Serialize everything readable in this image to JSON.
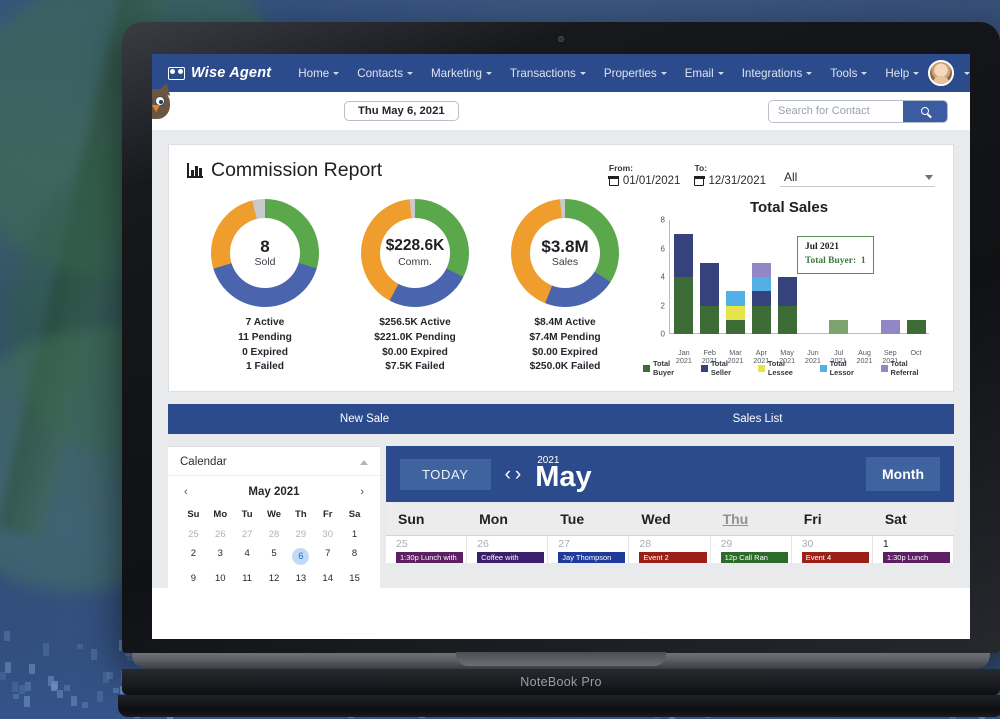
{
  "navbar": {
    "brand": "Wise Agent",
    "brand_icon": "wise-agent-logo-icon",
    "items": [
      {
        "label": "Home",
        "caret": true
      },
      {
        "label": "Contacts",
        "caret": true
      },
      {
        "label": "Marketing",
        "caret": true
      },
      {
        "label": "Transactions",
        "caret": true
      },
      {
        "label": "Properties",
        "caret": true
      },
      {
        "label": "Email",
        "caret": true
      },
      {
        "label": "Integrations",
        "caret": true
      },
      {
        "label": "Tools",
        "caret": true
      },
      {
        "label": "Help",
        "caret": true
      }
    ],
    "avatar_icon": "user-avatar",
    "avatar_caret_icon": "chevron-down-icon",
    "settings_icon": "gear-icon",
    "notifications_icon": "bell-icon"
  },
  "subbar": {
    "date_pill": "Thu May 6, 2021",
    "search_placeholder": "Search for Contact",
    "search_value": "",
    "search_icon": "search-icon",
    "mascot_icon": "owl-mascot-icon"
  },
  "report": {
    "title": "Commission Report",
    "title_icon": "bar-chart-icon",
    "filters": {
      "from_label": "From:",
      "from_value": "01/01/2021",
      "to_label": "To:",
      "to_value": "12/31/2021",
      "calendar_icon": "calendar-icon",
      "select_value": "All",
      "select_caret_icon": "chevron-down-icon"
    },
    "donuts": [
      {
        "value": "8",
        "label": "Sold",
        "stats": [
          "7 Active",
          "11 Pending",
          "0 Expired",
          "1 Failed"
        ],
        "segments": [
          {
            "name": "sold",
            "color": "#5aa84b",
            "pct": 29.6
          },
          {
            "name": "pending",
            "color": "#4a64ae",
            "pct": 40.7
          },
          {
            "name": "active",
            "color": "#ef9d2c",
            "pct": 25.9
          },
          {
            "name": "failed",
            "color": "#c8c9cb",
            "pct": 3.8
          }
        ]
      },
      {
        "value": "$228.6K",
        "label": "Comm.",
        "stats": [
          "$256.5K Active",
          "$221.0K Pending",
          "$0.00 Expired",
          "$7.5K Failed"
        ],
        "segments": [
          {
            "name": "comm",
            "color": "#5aa84b",
            "pct": 32.3
          },
          {
            "name": "pending",
            "color": "#4a64ae",
            "pct": 25.5
          },
          {
            "name": "active",
            "color": "#ef9d2c",
            "pct": 40.6
          },
          {
            "name": "failed",
            "color": "#c8c9cb",
            "pct": 1.6
          }
        ]
      },
      {
        "value": "$3.8M",
        "label": "Sales",
        "stats": [
          "$8.4M Active",
          "$7.4M Pending",
          "$0.00 Expired",
          "$250.0K Failed"
        ],
        "segments": [
          {
            "name": "sales",
            "color": "#5aa84b",
            "pct": 34.0
          },
          {
            "name": "pending",
            "color": "#4a64ae",
            "pct": 22.0
          },
          {
            "name": "active",
            "color": "#ef9d2c",
            "pct": 42.5
          },
          {
            "name": "failed",
            "color": "#c8c9cb",
            "pct": 1.5
          }
        ]
      }
    ],
    "tooltip": {
      "title": "Jul 2021",
      "row_label": "Total Buyer:",
      "row_value": "1"
    },
    "actions": [
      {
        "label": "New Sale"
      },
      {
        "label": "Sales List"
      }
    ]
  },
  "chart_data": {
    "type": "bar",
    "title": "Total Sales",
    "xlabel": "",
    "ylabel": "",
    "ylim": [
      0,
      8
    ],
    "yticks": [
      0,
      2,
      4,
      6,
      8
    ],
    "grid": false,
    "stacked": true,
    "legend_position": "bottom",
    "categories": [
      "Jan 2021",
      "Feb 2021",
      "Mar 2021",
      "Apr 2021",
      "May 2021",
      "Jun 2021",
      "Jul 2021",
      "Aug 2021",
      "Sep 2021",
      "Oct"
    ],
    "series": [
      {
        "name": "Total Buyer",
        "color": "#3d6b35",
        "values": [
          4,
          2,
          1,
          2,
          2,
          0,
          1,
          0,
          0,
          1
        ]
      },
      {
        "name": "Total Seller",
        "color": "#36427c",
        "values": [
          3,
          3,
          0,
          1,
          2,
          0,
          0,
          0,
          0,
          0
        ]
      },
      {
        "name": "Total Lessee",
        "color": "#e5e54a",
        "values": [
          0,
          0,
          1,
          0,
          0,
          0,
          0,
          0,
          0,
          0
        ]
      },
      {
        "name": "Total Lessor",
        "color": "#53b0e5",
        "values": [
          0,
          0,
          1,
          1,
          0,
          0,
          0,
          0,
          0,
          0
        ]
      },
      {
        "name": "Total Referral",
        "color": "#9287c4",
        "values": [
          0,
          0,
          0,
          1,
          0,
          0,
          0,
          0,
          1,
          0
        ]
      }
    ],
    "highlight": {
      "category": "Jul 2021",
      "series": "Total Buyer",
      "value": 1,
      "color": "#7fa36f"
    }
  },
  "calendar_sidebar": {
    "title": "Calendar",
    "collapse_icon": "chevron-up-icon",
    "month_title": "May 2021",
    "prev_icon": "chevron-left-icon",
    "next_icon": "chevron-right-icon",
    "dow": [
      "Su",
      "Mo",
      "Tu",
      "We",
      "Th",
      "Fr",
      "Sa"
    ],
    "weeks": [
      [
        {
          "d": "25",
          "mute": true
        },
        {
          "d": "26",
          "mute": true
        },
        {
          "d": "27",
          "mute": true
        },
        {
          "d": "28",
          "mute": true
        },
        {
          "d": "29",
          "mute": true
        },
        {
          "d": "30",
          "mute": true
        },
        {
          "d": "1"
        }
      ],
      [
        {
          "d": "2"
        },
        {
          "d": "3"
        },
        {
          "d": "4"
        },
        {
          "d": "5"
        },
        {
          "d": "6",
          "sel": true
        },
        {
          "d": "7"
        },
        {
          "d": "8"
        }
      ],
      [
        {
          "d": "9"
        },
        {
          "d": "10"
        },
        {
          "d": "11"
        },
        {
          "d": "12"
        },
        {
          "d": "13"
        },
        {
          "d": "14"
        },
        {
          "d": "15"
        }
      ]
    ]
  },
  "calendar_main": {
    "today_label": "TODAY",
    "prev_icon": "chevron-left-icon",
    "next_icon": "chevron-right-icon",
    "year": "2021",
    "month": "May",
    "view_label": "Month",
    "dow": [
      {
        "label": "Sun",
        "active": false
      },
      {
        "label": "Mon",
        "active": false
      },
      {
        "label": "Tue",
        "active": false
      },
      {
        "label": "Wed",
        "active": false
      },
      {
        "label": "Thu",
        "active": true
      },
      {
        "label": "Fri",
        "active": false
      },
      {
        "label": "Sat",
        "active": false
      }
    ],
    "days": [
      {
        "num": "25",
        "current": false,
        "events": [
          {
            "text": "1:30p Lunch with",
            "color": "#5c1f63"
          }
        ]
      },
      {
        "num": "26",
        "current": false,
        "events": [
          {
            "text": "Coffee with",
            "color": "#3b1f6b"
          }
        ]
      },
      {
        "num": "27",
        "current": false,
        "events": [
          {
            "text": "Jay Thompson",
            "color": "#1f3a9b"
          }
        ]
      },
      {
        "num": "28",
        "current": false,
        "events": [
          {
            "text": "Event 2",
            "color": "#9b2018"
          }
        ]
      },
      {
        "num": "29",
        "current": false,
        "events": [
          {
            "text": "12p Call Ran",
            "color": "#2c6b2a"
          }
        ]
      },
      {
        "num": "30",
        "current": false,
        "events": [
          {
            "text": "Event 4",
            "color": "#9b2018"
          }
        ]
      },
      {
        "num": "1",
        "current": true,
        "events": [
          {
            "text": "1:30p Lunch",
            "color": "#5c1f63"
          }
        ]
      }
    ]
  },
  "laptop": {
    "model": "NoteBook Pro"
  }
}
